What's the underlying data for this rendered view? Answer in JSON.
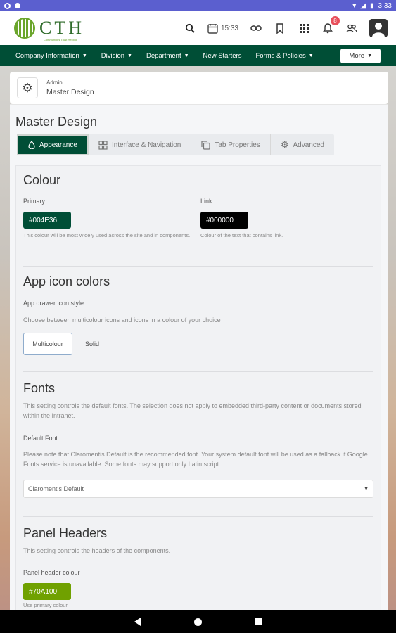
{
  "status_bar": {
    "time": "3:33"
  },
  "header": {
    "logo_text": "CTH",
    "logo_tagline": "Communities Trust Helping",
    "time_label": "15:33",
    "notification_count": "8"
  },
  "nav": {
    "items": [
      {
        "label": "Company Information",
        "has_dropdown": true
      },
      {
        "label": "Division",
        "has_dropdown": true
      },
      {
        "label": "Department",
        "has_dropdown": true
      },
      {
        "label": "New Starters",
        "has_dropdown": false
      },
      {
        "label": "Forms & Policies",
        "has_dropdown": true
      }
    ],
    "more_label": "More"
  },
  "breadcrumb": {
    "parent": "Admin",
    "current": "Master Design"
  },
  "page": {
    "title": "Master Design",
    "tabs": [
      {
        "label": "Appearance",
        "icon": "drop-icon",
        "active": true
      },
      {
        "label": "Interface & Navigation",
        "icon": "grid-icon",
        "active": false
      },
      {
        "label": "Tab Properties",
        "icon": "copy-icon",
        "active": false
      },
      {
        "label": "Advanced",
        "icon": "gear-icon",
        "active": false
      }
    ]
  },
  "colour": {
    "title": "Colour",
    "primary_label": "Primary",
    "primary_value": "#004E36",
    "primary_help": "This colour will be most widely used across the site and in components.",
    "link_label": "Link",
    "link_value": "#000000",
    "link_help": "Colour of the text that contains link."
  },
  "app_icons": {
    "title": "App icon colors",
    "style_label": "App drawer icon style",
    "style_hint": "Choose between multicolour icons and icons in a colour of your choice",
    "option_multicolour": "Multicolour",
    "option_solid": "Solid",
    "selected": "Multicolour"
  },
  "fonts": {
    "title": "Fonts",
    "intro": "This setting controls the default fonts. The selection does not apply to embedded third-party content or documents stored within the Intranet.",
    "default_font_label": "Default Font",
    "default_font_hint": "Please note that Claromentis Default is the recommended font. Your system default font will be used as a fallback if Google Fonts service is unavailable. Some fonts may support only Latin script.",
    "selected_font": "Claromentis Default"
  },
  "panel_headers": {
    "title": "Panel Headers",
    "intro": "This setting controls the headers of the components.",
    "colour_label": "Panel header colour",
    "colour_value": "#70A100",
    "use_primary": "Use primary colour"
  },
  "colors": {
    "primary": "#004E36",
    "link": "#000000",
    "panel_header": "#70A100"
  }
}
